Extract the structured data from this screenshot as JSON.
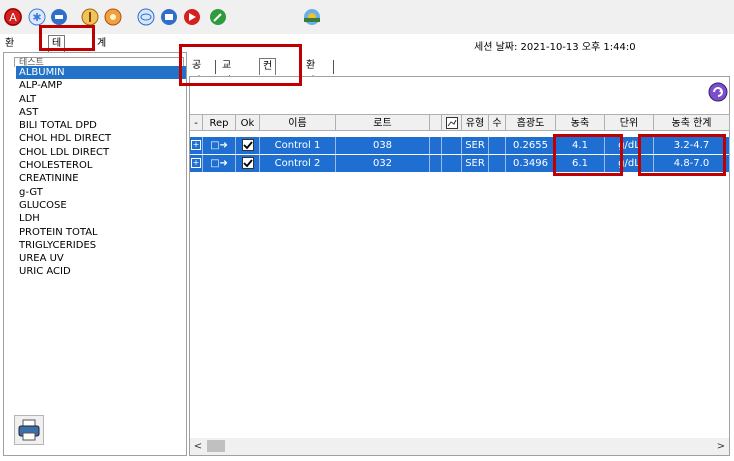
{
  "toolbar": {
    "icons": [
      {
        "name": "shutdown-icon",
        "color": "#d62020"
      },
      {
        "name": "snowflake-icon",
        "color": "#3a7be0"
      },
      {
        "name": "vial-icon",
        "color": "#2f6fc9"
      },
      {
        "name": "circle-button-icon",
        "color": "#e0a23a"
      },
      {
        "name": "sunflower-icon",
        "color": "#e07b20"
      },
      {
        "name": "tray-icon",
        "color": "#3a7be0"
      },
      {
        "name": "cassette-icon",
        "color": "#2f6fc9"
      },
      {
        "name": "flag-icon",
        "color": "#d62020"
      },
      {
        "name": "wrench-icon",
        "color": "#2e9b3c"
      },
      {
        "name": "sun-horizon-icon",
        "color": "#f0c030"
      }
    ]
  },
  "outer_tabs": [
    "환자",
    "테스트",
    "계산됨"
  ],
  "session_text": "세션 날짜: 2021-10-13 오후 1:44:0",
  "test_list": {
    "header": "테스트",
    "items": [
      "ALBUMIN",
      "ALP-AMP",
      "ALT",
      "AST",
      "BILI TOTAL DPD",
      "CHOL HDL DIRECT",
      "CHOL LDL DIRECT",
      "CHOLESTEROL",
      "CREATININE",
      "g-GT",
      "GLUCOSE",
      "LDH",
      "PROTEIN TOTAL",
      "TRIGLYCERIDES",
      "UREA UV",
      "URIC ACID"
    ],
    "selected": "ALBUMIN"
  },
  "inner_tabs": [
    "공란",
    "교정기",
    "컨트롤",
    "환자"
  ],
  "table": {
    "headers": [
      "-",
      "Rep",
      "Ok",
      "이름",
      "로트",
      "",
      "",
      "유형",
      "수",
      "흡광도",
      "농축",
      "단위",
      "농축 한계"
    ],
    "rows": [
      {
        "name": "Control 1",
        "lot": "038",
        "type": "SER",
        "count": "",
        "absorbance": "0.2655",
        "conc": "4.1",
        "unit": "g/dL",
        "limits": "3.2-4.7"
      },
      {
        "name": "Control 2",
        "lot": "032",
        "type": "SER",
        "count": "",
        "absorbance": "0.3496",
        "conc": "6.1",
        "unit": "g/dL",
        "limits": "4.8-7.0"
      }
    ]
  },
  "colors": {
    "selection": "#1f6fd2",
    "highlight": "#c00000"
  }
}
